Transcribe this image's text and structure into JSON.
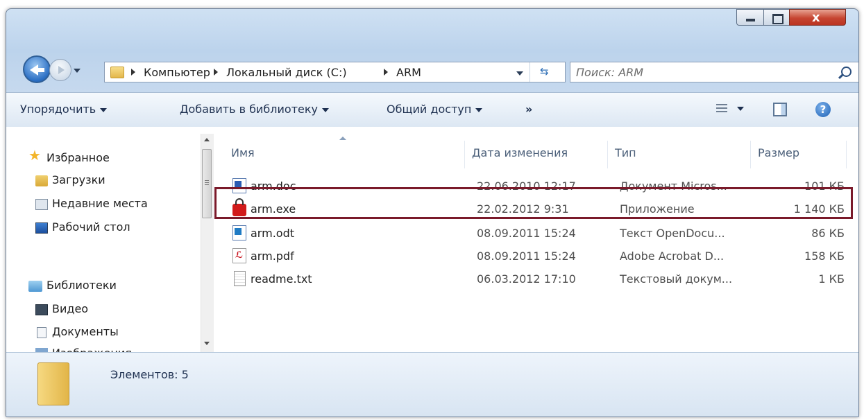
{
  "window": {
    "caption_buttons": [
      "minimize",
      "maximize",
      "close"
    ]
  },
  "address": {
    "crumbs": [
      "Компьютер",
      "Локальный диск (C:)",
      "ARM"
    ],
    "search_placeholder": "Поиск: ARM"
  },
  "toolbar": {
    "organize": "Упорядочить",
    "add_library": "Добавить в библиотеку",
    "share": "Общий доступ",
    "more": "»"
  },
  "nav": {
    "favorites": "Избранное",
    "downloads": "Загрузки",
    "recent": "Недавние места",
    "desktop": "Рабочий стол",
    "libraries": "Библиотеки",
    "video": "Видео",
    "documents": "Документы",
    "images": "Изображения"
  },
  "columns": {
    "name": "Имя",
    "date": "Дата изменения",
    "type": "Тип",
    "size": "Размер"
  },
  "files": [
    {
      "name": "arm.doc",
      "date": "22.06.2010 12:17",
      "type": "Документ Micros...",
      "size": "101 КБ",
      "icon": "word-doc-icon"
    },
    {
      "name": "arm.exe",
      "date": "22.02.2012 9:31",
      "type": "Приложение",
      "size": "1 140 КБ",
      "icon": "lock-exe-icon"
    },
    {
      "name": "arm.odt",
      "date": "08.09.2011 15:24",
      "type": "Текст OpenDocu...",
      "size": "86 КБ",
      "icon": "odt-icon"
    },
    {
      "name": "arm.pdf",
      "date": "08.09.2011 15:24",
      "type": "Adobe Acrobat D...",
      "size": "158 КБ",
      "icon": "pdf-icon"
    },
    {
      "name": "readme.txt",
      "date": "06.03.2012 17:10",
      "type": "Текстовый докум...",
      "size": "1 КБ",
      "icon": "text-file-icon"
    }
  ],
  "status": {
    "items_count": "Элементов: 5"
  },
  "colors": {
    "highlight": "#7a1a2a",
    "close_button": "#c64531",
    "chrome": "#c6d9ee"
  }
}
